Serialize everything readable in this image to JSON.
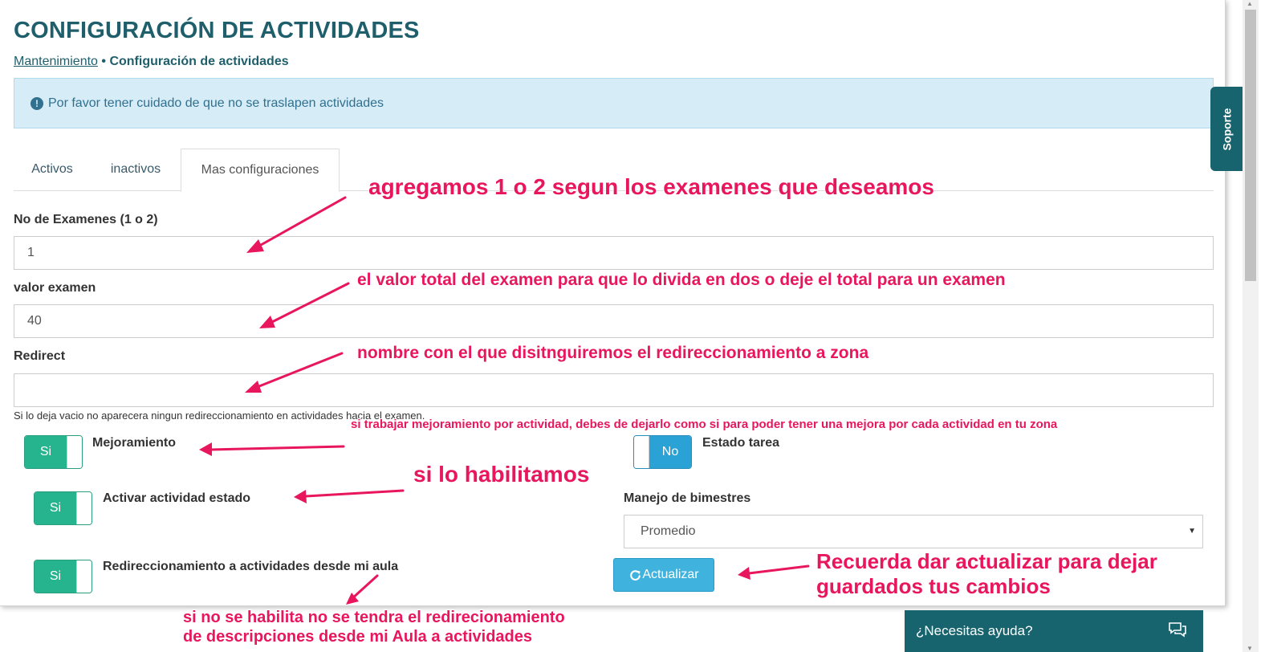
{
  "page": {
    "title": "CONFIGURACIÓN DE ACTIVIDADES",
    "breadcrumb_link": "Mantenimiento",
    "breadcrumb_separator": " • ",
    "breadcrumb_current": "Configuración de actividades"
  },
  "alert": {
    "icon": "exclamation-circle-icon",
    "icon_glyph": "!",
    "text": "Por favor tener cuidado de que no se traslapen actividades"
  },
  "tabs": [
    {
      "label": "Activos",
      "active": false
    },
    {
      "label": "inactivos",
      "active": false
    },
    {
      "label": "Mas configuraciones",
      "active": true
    }
  ],
  "form": {
    "exams_label": "No de Examenes (1 o 2)",
    "exams_value": "1",
    "exam_value_label": "valor examen",
    "exam_value": "40",
    "redirect_label": "Redirect",
    "redirect_value": "",
    "redirect_help": "Si lo deja vacio no aparecera ningun redireccionamiento en actividades hacia el examen.",
    "toggles": {
      "mejoramiento": {
        "label": "Mejoramiento",
        "state": "Si"
      },
      "estado_tarea": {
        "label": "Estado tarea",
        "state": "No"
      },
      "activar_estado": {
        "label": "Activar actividad estado",
        "state": "Si"
      },
      "redireccionamiento": {
        "label": "Redireccionamiento a actividades desde mi aula",
        "state": "Si"
      }
    },
    "bimestres_label": "Manejo de bimestres",
    "bimestres_selected": "Promedio",
    "update_label": "Actualizar",
    "update_icon": "refresh-icon"
  },
  "sidebar_tab": "Soporte",
  "help_widget": {
    "text": "¿Necesitas ayuda?",
    "icon": "chat-icon"
  },
  "annotations": {
    "a1": "agregamos 1 o 2 segun los examenes que deseamos",
    "a2": "el valor total del examen para que lo divida en dos o deje el total para un examen",
    "a3": "nombre con el que disitnguiremos el redireccionamiento a zona",
    "a4": "si trabajar mejoramiento por actividad, debes de dejarlo como si para poder tener una mejora por cada actividad en tu zona",
    "a5": "si lo habilitamos",
    "a6": "Recuerda dar actualizar para dejar guardados tus cambios",
    "a7": "si no se habilita no se tendra el redirecionamiento de descripciones desde mi Aula a actividades"
  },
  "colors": {
    "heading": "#1f5f6b",
    "alert_bg": "#d6ecf7",
    "toggle_on": "#26b48f",
    "toggle_blue": "#2aa2d6",
    "button": "#3fb3de",
    "widget": "#17646e",
    "annotation": "#e8175d"
  }
}
